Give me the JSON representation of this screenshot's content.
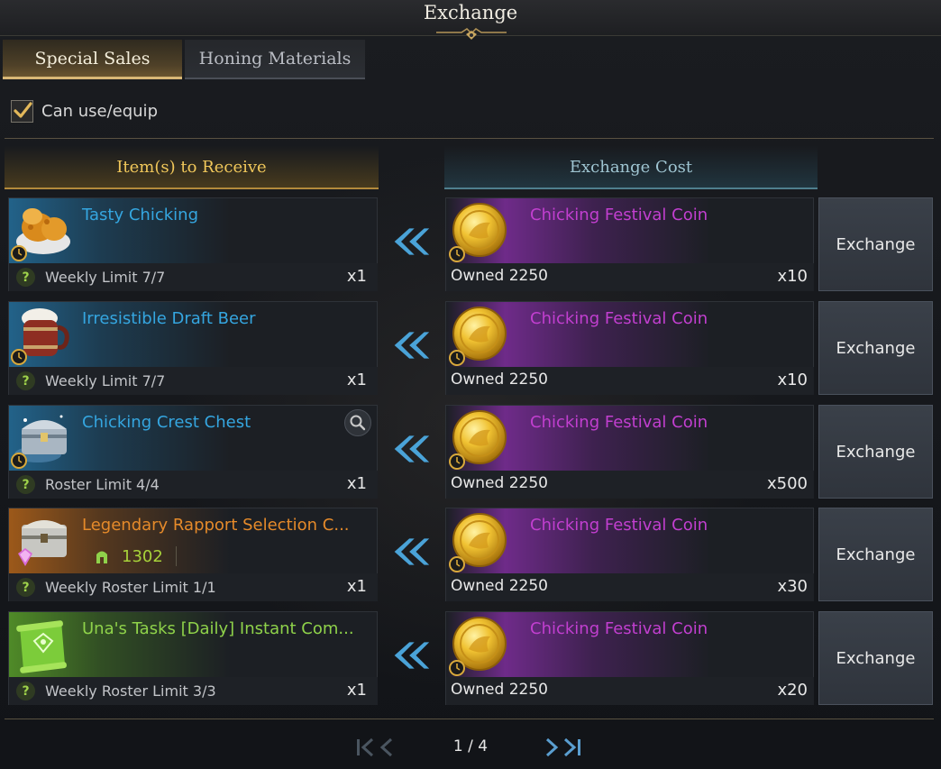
{
  "window": {
    "title": "Exchange"
  },
  "tabs": [
    {
      "label": "Special Sales",
      "active": true
    },
    {
      "label": "Honing Materials",
      "active": false
    }
  ],
  "filter": {
    "label": "Can use/equip",
    "checked": true
  },
  "columns": {
    "receive": "Item(s) to Receive",
    "cost": "Exchange Cost"
  },
  "rows": [
    {
      "item": {
        "name": "Tasty Chicking",
        "name_color": "#35a6e0",
        "icon": "fried-chicken-icon",
        "limit": "Weekly Limit 7/7",
        "qty": "x1"
      },
      "cost": {
        "currency": "Chicking Festival Coin",
        "icon": "gold-coin-icon",
        "owned": "Owned 2250",
        "qty": "x10"
      },
      "button": "Exchange"
    },
    {
      "item": {
        "name": "Irresistible Draft Beer",
        "name_color": "#35a6e0",
        "icon": "beer-mug-icon",
        "limit": "Weekly Limit 7/7",
        "qty": "x1"
      },
      "cost": {
        "currency": "Chicking Festival Coin",
        "icon": "gold-coin-icon",
        "owned": "Owned 2250",
        "qty": "x10"
      },
      "button": "Exchange"
    },
    {
      "item": {
        "name": "Chicking Crest Chest",
        "name_color": "#35a6e0",
        "icon": "chest-icon",
        "limit": "Roster Limit 4/4",
        "qty": "x1"
      },
      "cost": {
        "currency": "Chicking Festival Coin",
        "icon": "gold-coin-icon",
        "owned": "Owned 2250",
        "qty": "x500"
      },
      "button": "Exchange"
    },
    {
      "item": {
        "name": "Legendary Rapport Selection C...",
        "name_color": "#e58a2a",
        "icon": "rapport-chest-icon",
        "rapport": "1302",
        "limit": "Weekly Roster Limit 1/1",
        "qty": "x1"
      },
      "cost": {
        "currency": "Chicking Festival Coin",
        "icon": "gold-coin-icon",
        "owned": "Owned 2250",
        "qty": "x30"
      },
      "button": "Exchange"
    },
    {
      "item": {
        "name": "Una's Tasks [Daily] Instant Com...",
        "name_color": "#8fd24a",
        "icon": "scroll-icon",
        "limit": "Weekly Roster Limit 3/3",
        "qty": "x1"
      },
      "cost": {
        "currency": "Chicking Festival Coin",
        "icon": "gold-coin-icon",
        "owned": "Owned 2250",
        "qty": "x20"
      },
      "button": "Exchange"
    }
  ],
  "pagination": {
    "text": "1 / 4"
  },
  "colors": {
    "gold": "#f0c75a",
    "blue_header": "#9fc5d2",
    "coin_purple": "#c23fd0",
    "accent_blue": "#4aa3d8"
  }
}
